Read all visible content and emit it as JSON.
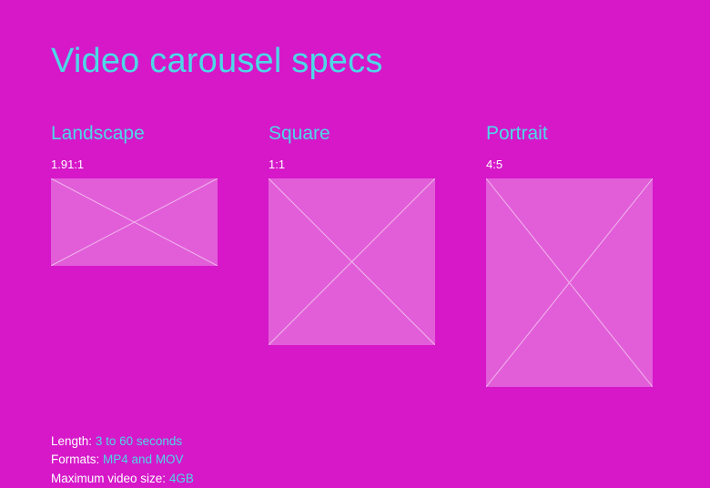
{
  "title": "Video carousel specs",
  "columns": [
    {
      "name": "Landscape",
      "ratio": "1.91:1"
    },
    {
      "name": "Square",
      "ratio": "1:1"
    },
    {
      "name": "Portrait",
      "ratio": "4:5"
    }
  ],
  "specs": {
    "length_label": "Length:",
    "length_value": "3 to 60 seconds",
    "formats_label": "Formats:",
    "formats_value": "MP4 and MOV",
    "maxsize_label": "Maximum video size:",
    "maxsize_value": "4GB"
  }
}
